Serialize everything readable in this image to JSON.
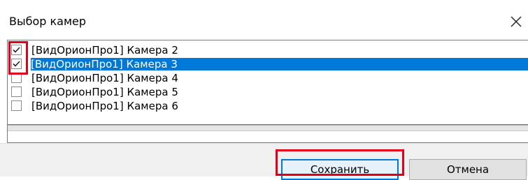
{
  "window": {
    "title": "Выбор камер",
    "close_icon": "close-icon"
  },
  "cameras": [
    {
      "label": "[ВидОрионПро1] Камера 2",
      "checked": true,
      "selected": false
    },
    {
      "label": "[ВидОрионПро1] Камера 3",
      "checked": true,
      "selected": true
    },
    {
      "label": "[ВидОрионПро1] Камера 4",
      "checked": false,
      "selected": false
    },
    {
      "label": "[ВидОрионПро1] Камера 5",
      "checked": false,
      "selected": false
    },
    {
      "label": "[ВидОрионПро1] Камера 6",
      "checked": false,
      "selected": false
    }
  ],
  "buttons": {
    "save": "Сохранить",
    "cancel": "Отмена"
  },
  "colors": {
    "selection": "#0078d7",
    "annotation": "#e0001a",
    "footer": "#f0f0f0"
  }
}
